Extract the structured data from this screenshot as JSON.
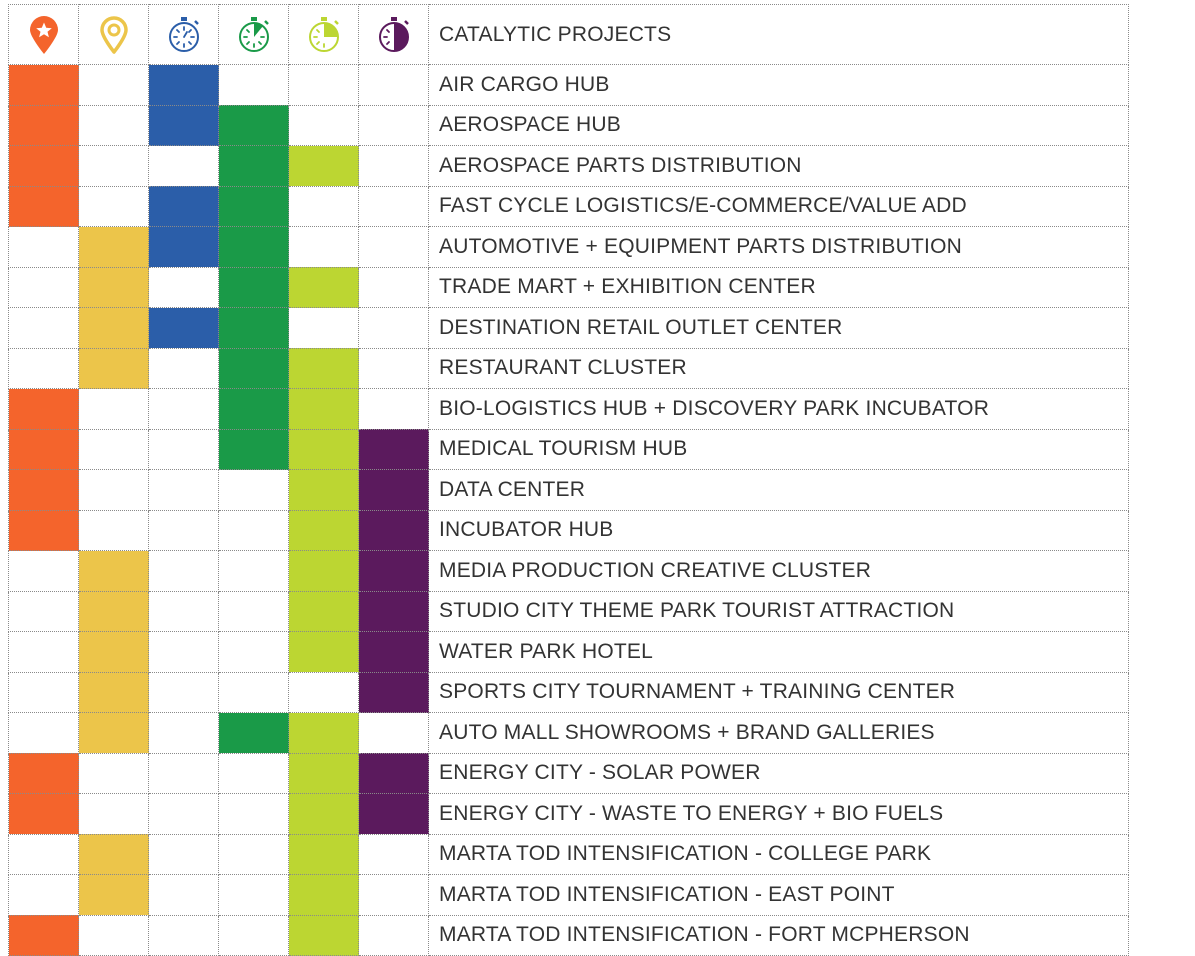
{
  "chart_data": {
    "type": "table",
    "title": "CATALYTIC PROJECTS",
    "columns": [
      {
        "icon": "star-map-pin-icon",
        "color": "#f4642c"
      },
      {
        "icon": "map-pin-outline-icon",
        "color": "#ecc54a"
      },
      {
        "icon": "stopwatch-blue-icon",
        "color": "#2b5ea9"
      },
      {
        "icon": "stopwatch-green-icon",
        "color": "#1a9a48"
      },
      {
        "icon": "stopwatch-lime-icon",
        "color": "#bcd632"
      },
      {
        "icon": "stopwatch-purple-icon",
        "color": "#5b1a5d"
      }
    ],
    "rows": [
      {
        "label": "AIR CARGO HUB",
        "values": [
          1,
          0,
          1,
          0,
          0,
          0
        ]
      },
      {
        "label": "AEROSPACE HUB",
        "values": [
          1,
          0,
          1,
          1,
          0,
          0
        ]
      },
      {
        "label": "AEROSPACE PARTS DISTRIBUTION",
        "values": [
          1,
          0,
          0,
          1,
          1,
          0
        ]
      },
      {
        "label": "FAST CYCLE LOGISTICS/E-COMMERCE/VALUE ADD",
        "values": [
          1,
          0,
          1,
          1,
          0,
          0
        ]
      },
      {
        "label": "AUTOMOTIVE + EQUIPMENT PARTS DISTRIBUTION",
        "values": [
          0,
          1,
          1,
          1,
          0,
          0
        ]
      },
      {
        "label": "TRADE MART + EXHIBITION CENTER",
        "values": [
          0,
          1,
          0,
          1,
          1,
          0
        ]
      },
      {
        "label": "DESTINATION RETAIL OUTLET CENTER",
        "values": [
          0,
          1,
          1,
          1,
          0,
          0
        ]
      },
      {
        "label": "RESTAURANT CLUSTER",
        "values": [
          0,
          1,
          0,
          1,
          1,
          0
        ]
      },
      {
        "label": "BIO-LOGISTICS HUB + DISCOVERY PARK INCUBATOR",
        "values": [
          1,
          0,
          0,
          1,
          1,
          0
        ]
      },
      {
        "label": "MEDICAL TOURISM HUB",
        "values": [
          1,
          0,
          0,
          1,
          1,
          1
        ]
      },
      {
        "label": "DATA CENTER",
        "values": [
          1,
          0,
          0,
          0,
          1,
          1
        ]
      },
      {
        "label": "INCUBATOR HUB",
        "values": [
          1,
          0,
          0,
          0,
          1,
          1
        ]
      },
      {
        "label": "MEDIA PRODUCTION CREATIVE CLUSTER",
        "values": [
          0,
          1,
          0,
          0,
          1,
          1
        ]
      },
      {
        "label": "STUDIO CITY THEME PARK TOURIST ATTRACTION",
        "values": [
          0,
          1,
          0,
          0,
          1,
          1
        ]
      },
      {
        "label": "WATER PARK HOTEL",
        "values": [
          0,
          1,
          0,
          0,
          1,
          1
        ]
      },
      {
        "label": "SPORTS CITY TOURNAMENT + TRAINING CENTER",
        "values": [
          0,
          1,
          0,
          0,
          0,
          1
        ]
      },
      {
        "label": "AUTO MALL SHOWROOMS + BRAND GALLERIES",
        "values": [
          0,
          1,
          0,
          1,
          1,
          0
        ]
      },
      {
        "label": "ENERGY CITY - SOLAR POWER",
        "values": [
          1,
          0,
          0,
          0,
          1,
          1
        ]
      },
      {
        "label": "ENERGY CITY - WASTE TO ENERGY + BIO FUELS",
        "values": [
          1,
          0,
          0,
          0,
          1,
          1
        ]
      },
      {
        "label": "MARTA TOD INTENSIFICATION - COLLEGE PARK",
        "values": [
          0,
          1,
          0,
          0,
          1,
          0
        ]
      },
      {
        "label": "MARTA TOD INTENSIFICATION - EAST POINT",
        "values": [
          0,
          1,
          0,
          0,
          1,
          0
        ]
      },
      {
        "label": "MARTA TOD INTENSIFICATION - FORT MCPHERSON",
        "values": [
          1,
          0,
          0,
          0,
          1,
          0
        ]
      }
    ]
  }
}
